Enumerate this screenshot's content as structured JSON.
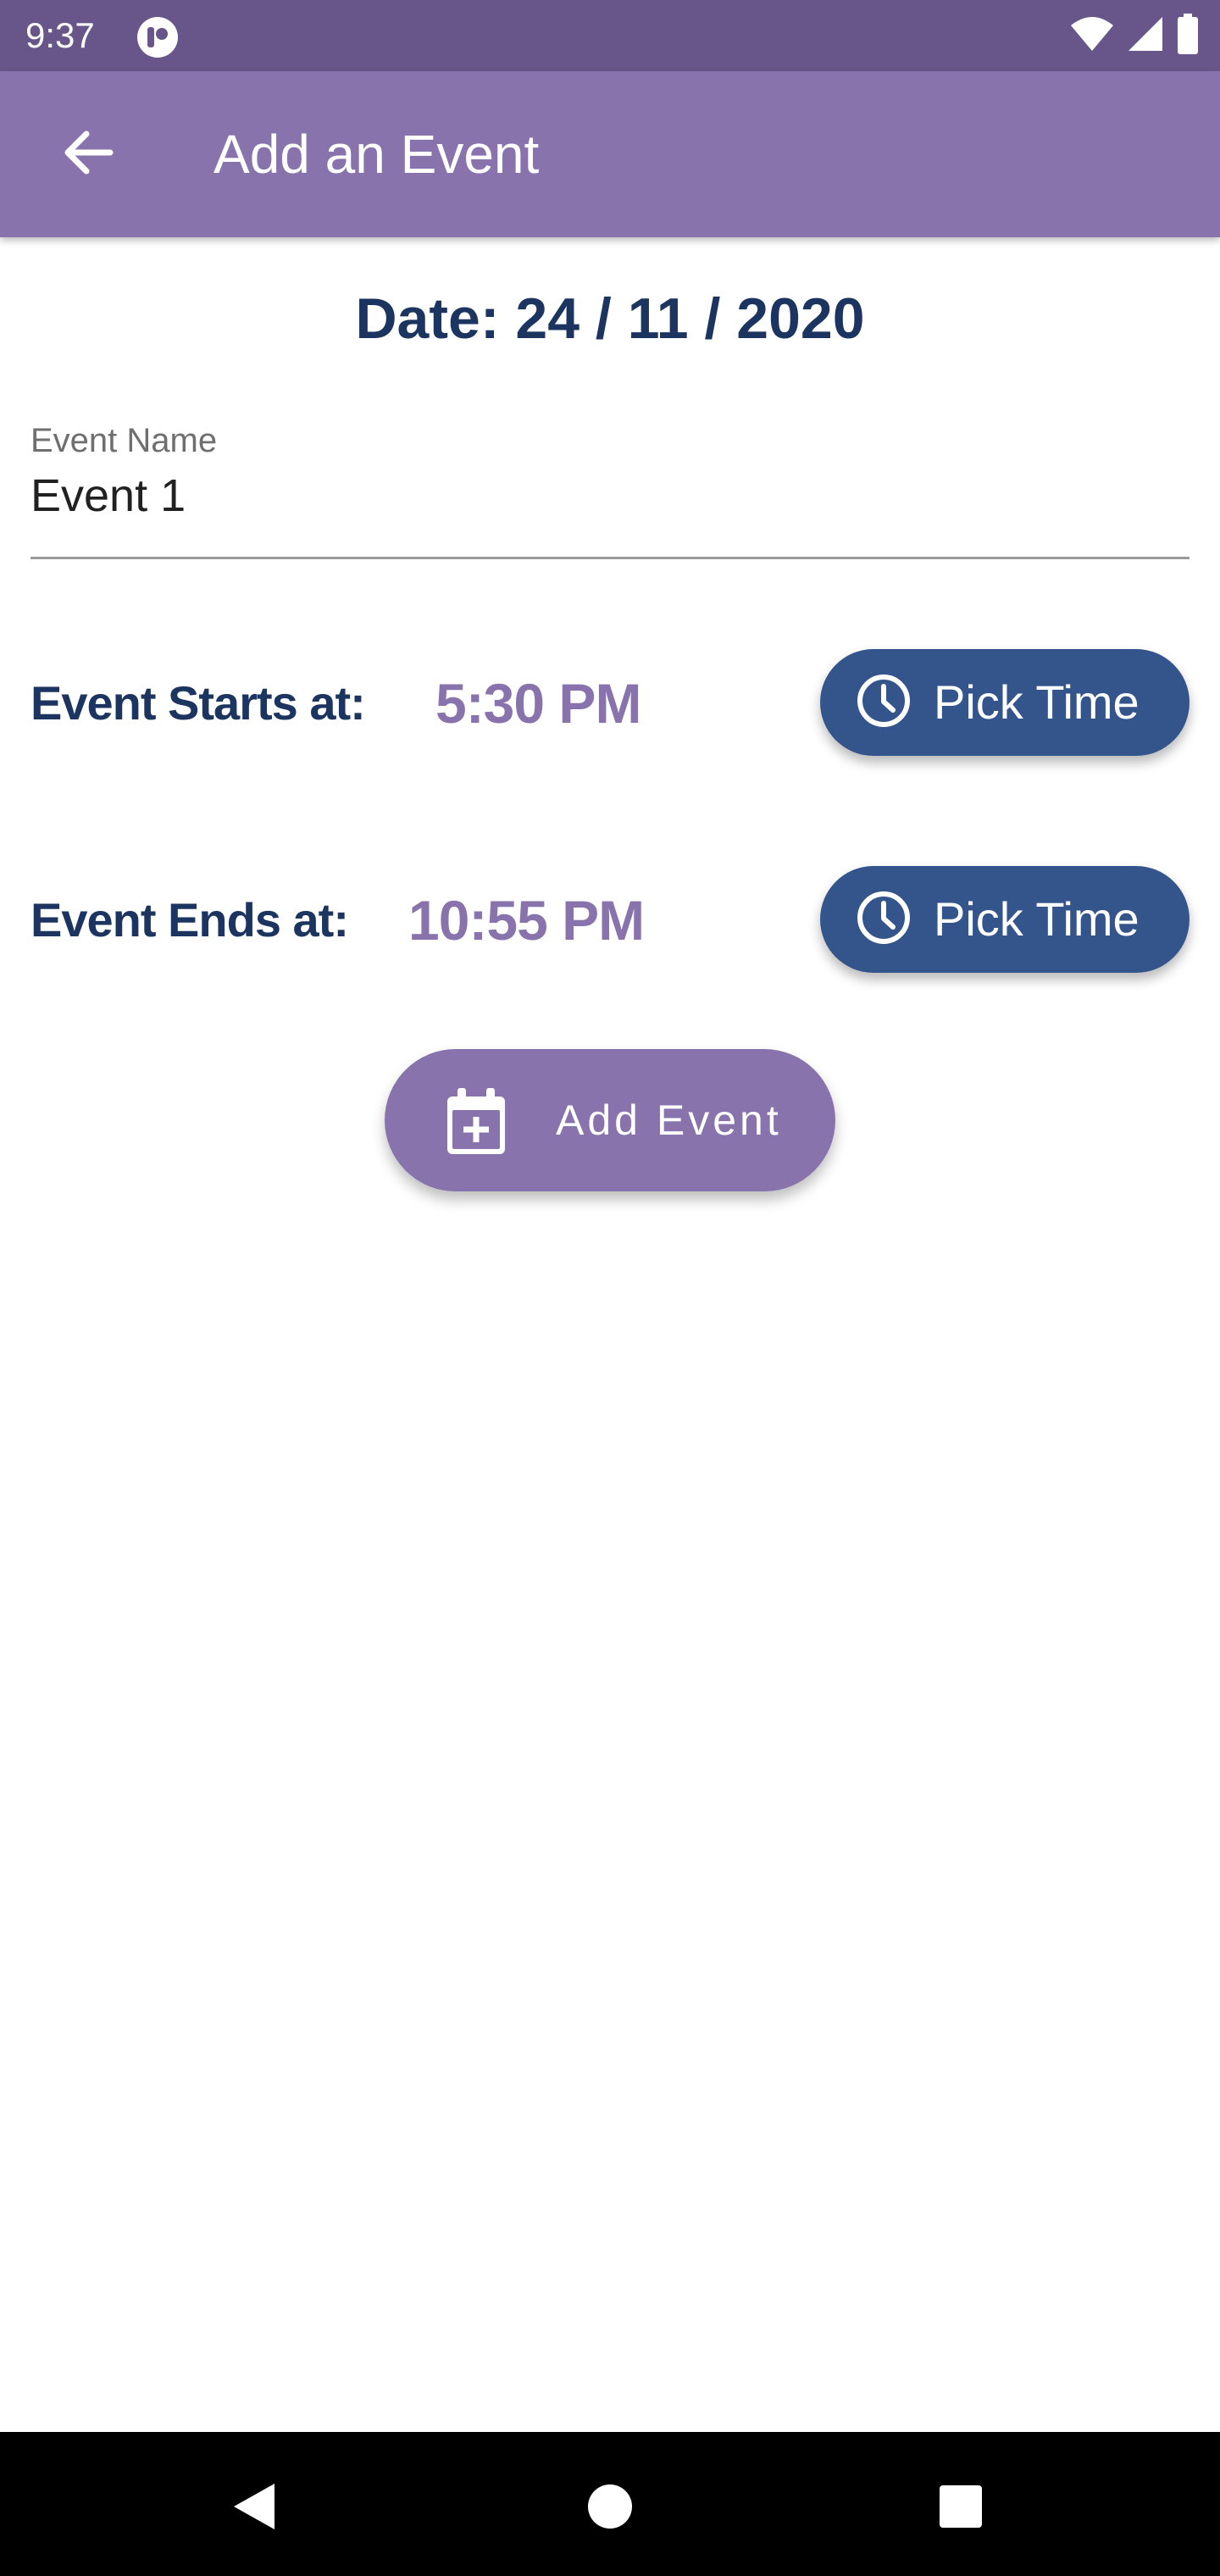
{
  "status_bar": {
    "time": "9:37",
    "icons": [
      "app-notification-icon",
      "wifi-icon",
      "signal-icon",
      "battery-icon"
    ]
  },
  "app_bar": {
    "title": "Add an Event",
    "back_icon": "arrow-left-icon"
  },
  "date_heading": "Date: 24 / 11 / 2020",
  "event_name_field": {
    "label": "Event Name",
    "value": "Event 1"
  },
  "start_row": {
    "label": "Event Starts at:",
    "time": "5:30 PM",
    "button_label": "Pick Time",
    "button_icon": "clock-icon"
  },
  "end_row": {
    "label": "Event Ends at:",
    "time": "10:55 PM",
    "button_label": "Pick Time",
    "button_icon": "clock-icon"
  },
  "add_event_button": {
    "label": "Add Event",
    "icon": "calendar-plus-icon"
  },
  "nav_bar": {
    "buttons": [
      "back-triangle-icon",
      "home-circle-icon",
      "recents-square-icon"
    ]
  },
  "colors": {
    "status_bar": "#68568a",
    "app_bar": "#8873ad",
    "heading_text": "#1b3560",
    "time_value": "#8873ad",
    "pick_button": "#34558c",
    "add_button": "#8873ad"
  }
}
